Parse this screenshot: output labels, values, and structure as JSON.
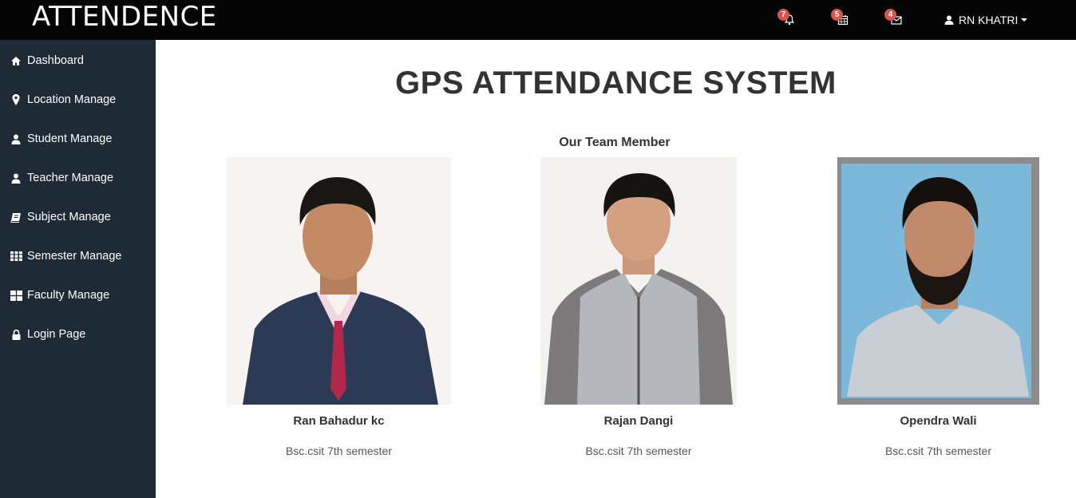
{
  "header": {
    "brand": "ATTENDENCE",
    "notifications": [
      {
        "icon": "bell-icon",
        "count": "7"
      },
      {
        "icon": "calendar-icon",
        "count": "5"
      },
      {
        "icon": "envelope-icon",
        "count": "4"
      }
    ],
    "user": {
      "icon": "user-icon",
      "name": "RN KHATRI"
    }
  },
  "sidebar": {
    "items": [
      {
        "icon": "home-icon",
        "label": "Dashboard"
      },
      {
        "icon": "map-marker-icon",
        "label": "Location Manage"
      },
      {
        "icon": "user-icon",
        "label": "Student Manage"
      },
      {
        "icon": "user-icon",
        "label": "Teacher Manage"
      },
      {
        "icon": "book-icon",
        "label": "Subject Manage"
      },
      {
        "icon": "th-icon",
        "label": "Semester Manage"
      },
      {
        "icon": "th-large-icon",
        "label": "Faculty Manage"
      },
      {
        "icon": "lock-icon",
        "label": "Login Page"
      }
    ]
  },
  "main": {
    "title": "GPS ATTENDANCE SYSTEM",
    "section_title": "Our Team Member",
    "members": [
      {
        "name": "Ran Bahadur kc",
        "role": "Bsc.csit 7th semester"
      },
      {
        "name": "Rajan Dangi",
        "role": "Bsc.csit 7th semester"
      },
      {
        "name": "Opendra Wali",
        "role": "Bsc.csit 7th semester"
      }
    ]
  },
  "colors": {
    "topbar": "#050505",
    "sidebar": "#1e2b36",
    "badge": "#d9534f",
    "heading": "#333333"
  }
}
